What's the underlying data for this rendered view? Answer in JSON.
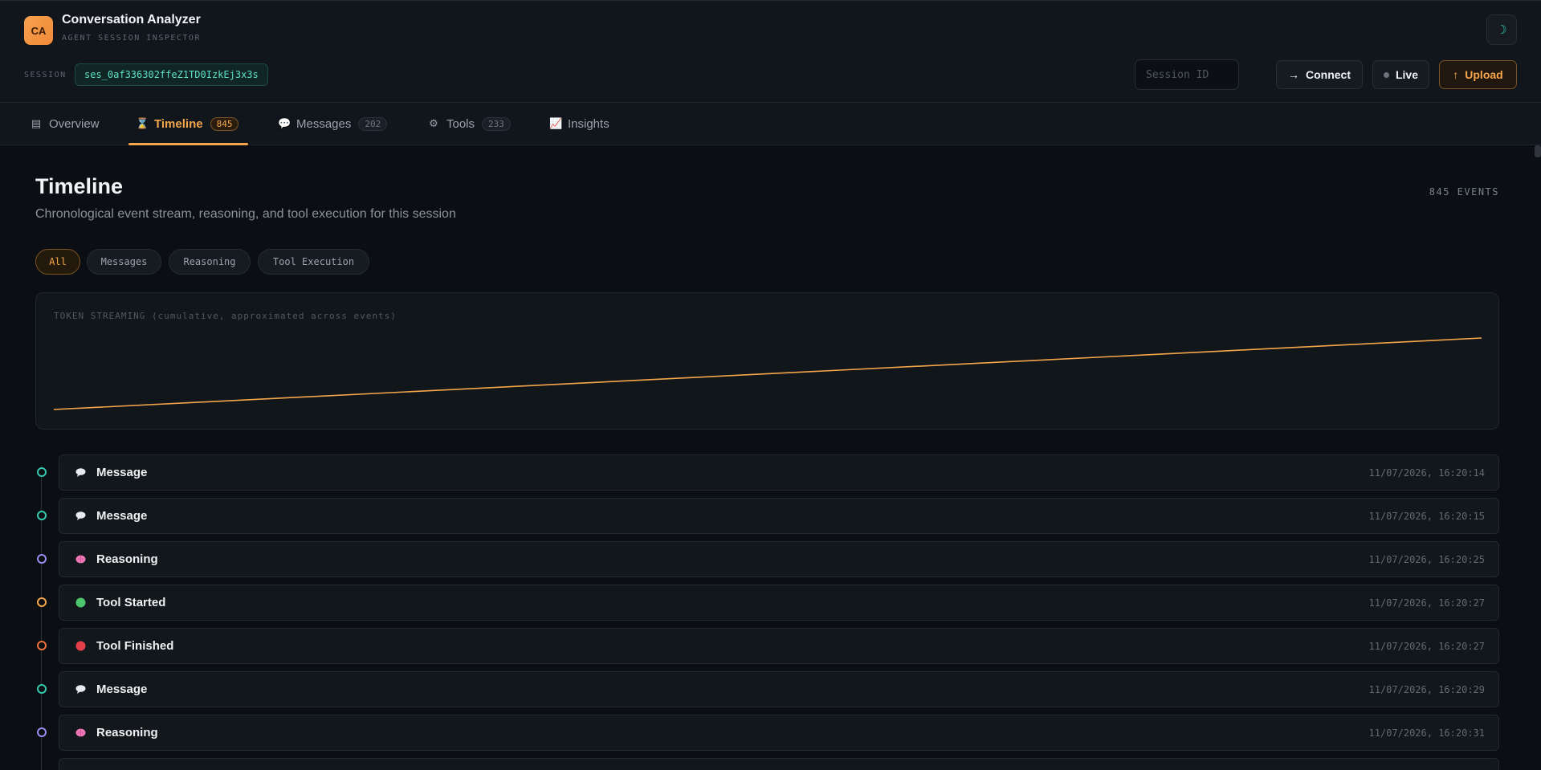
{
  "app": {
    "logo": "CA",
    "title": "Conversation Analyzer",
    "subtitle": "AGENT SESSION INSPECTOR",
    "theme_icon": "☽"
  },
  "session": {
    "label": "SESSION",
    "id": "ses_0af336302ffeZ1TD0IzkEj3x3s",
    "input_placeholder": "Session ID"
  },
  "actions": {
    "connect_icon": "→",
    "connect": "Connect",
    "live": "Live",
    "upload_icon": "↑",
    "upload": "Upload"
  },
  "tabs": [
    {
      "icon": "▤",
      "label": "Overview",
      "badge": ""
    },
    {
      "icon": "⌛",
      "label": "Timeline",
      "badge": "845"
    },
    {
      "icon": "💬",
      "label": "Messages",
      "badge": "202"
    },
    {
      "icon": "⚙",
      "label": "Tools",
      "badge": "233"
    },
    {
      "icon": "📈",
      "label": "Insights",
      "badge": ""
    }
  ],
  "page": {
    "title": "Timeline",
    "subtitle": "Chronological event stream, reasoning, and tool execution for this session",
    "event_count": "845 EVENTS"
  },
  "filters": [
    "All",
    "Messages",
    "Reasoning",
    "Tool Execution"
  ],
  "chart_data": {
    "type": "line",
    "title": "TOKEN STREAMING (cumulative, approximated across events)",
    "color": "#f6a64a",
    "series": [
      {
        "values": [
          0,
          1
        ]
      }
    ]
  },
  "events": [
    {
      "label": "Message",
      "time": "11/07/2026, 16:20:14",
      "icon": "speech-bubble-icon",
      "dot_color": "#35c9b0"
    },
    {
      "label": "Message",
      "time": "11/07/2026, 16:20:15",
      "icon": "speech-bubble-icon",
      "dot_color": "#35c9b0"
    },
    {
      "label": "Reasoning",
      "time": "11/07/2026, 16:20:25",
      "icon": "brain-icon",
      "dot_color": "#9b8cf0"
    },
    {
      "label": "Tool Started",
      "time": "11/07/2026, 16:20:27",
      "icon": "green-circle-icon",
      "dot_color": "#f6a64a"
    },
    {
      "label": "Tool Finished",
      "time": "11/07/2026, 16:20:27",
      "icon": "red-circle-icon",
      "dot_color": "#f0703a"
    },
    {
      "label": "Message",
      "time": "11/07/2026, 16:20:29",
      "icon": "speech-bubble-icon",
      "dot_color": "#35c9b0"
    },
    {
      "label": "Reasoning",
      "time": "11/07/2026, 16:20:31",
      "icon": "brain-icon",
      "dot_color": "#9b8cf0"
    },
    {
      "label": "",
      "time": "",
      "icon": "",
      "dot_color": "#35c9b0"
    }
  ]
}
